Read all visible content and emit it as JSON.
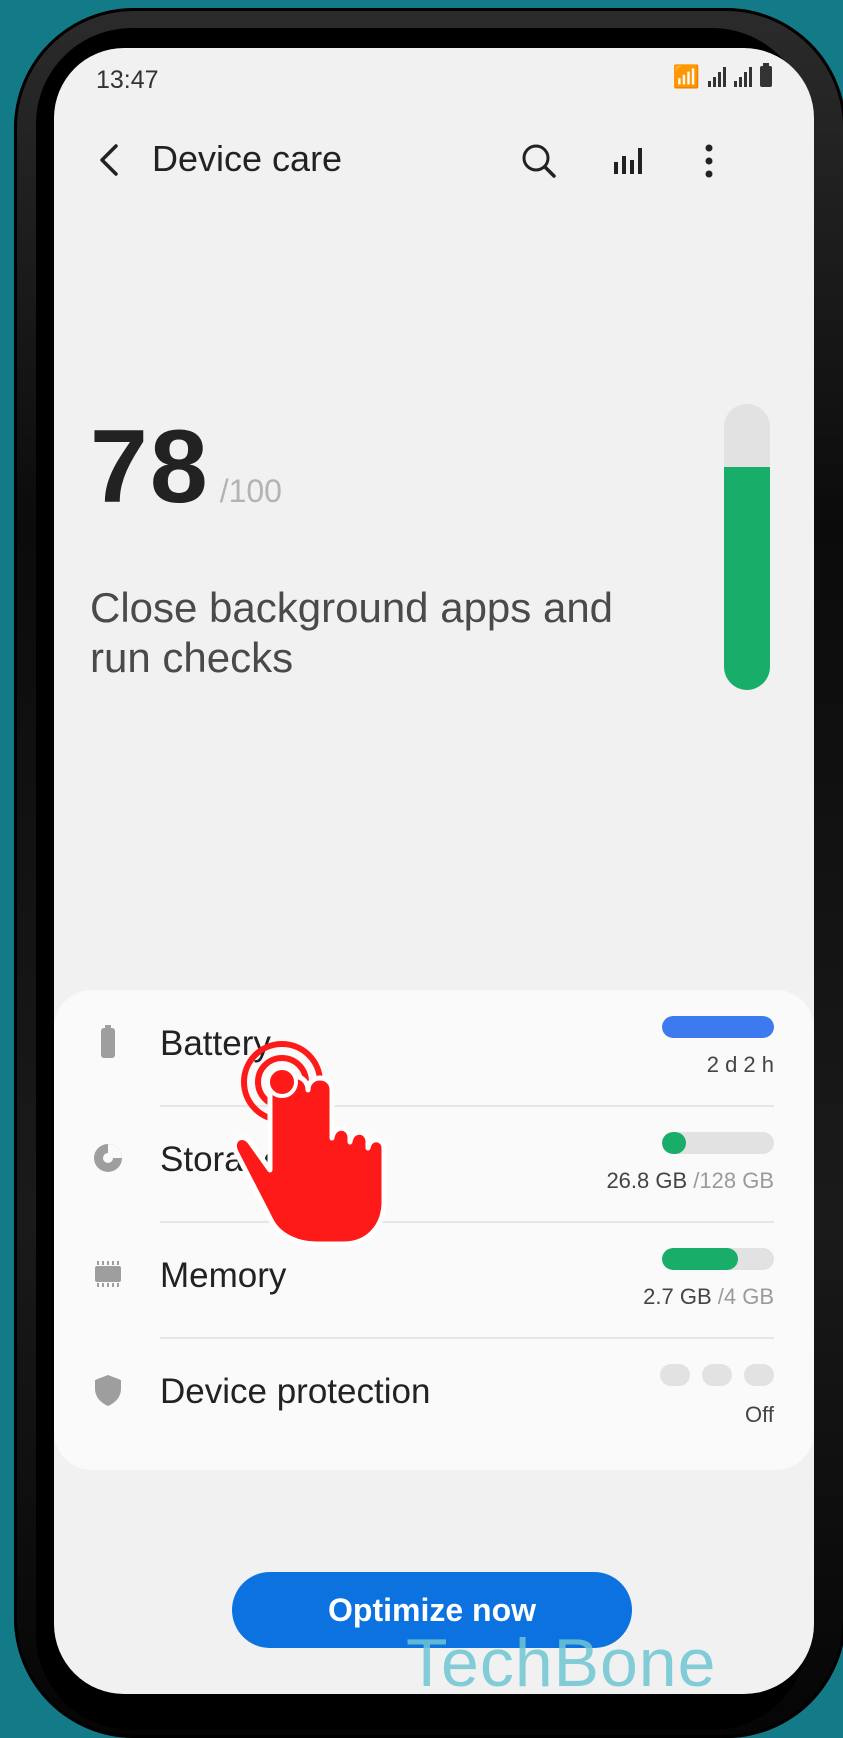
{
  "status_bar": {
    "time": "13:47"
  },
  "header": {
    "title": "Device care",
    "back_icon": "back-arrow-icon",
    "actions": [
      "search-icon",
      "stats-icon",
      "more-options-icon"
    ]
  },
  "score": {
    "value": "78",
    "max": "/100",
    "message": "Close background apps and run checks",
    "gauge_fraction": 0.78,
    "gauge_color": "#19ad6a"
  },
  "items": [
    {
      "label": "Battery",
      "value": "2 d 2 h",
      "bar_fraction": 1.0,
      "bar_color": "#3d7af0",
      "icon": "battery-icon"
    },
    {
      "label": "Storage",
      "value": "26.8 GB",
      "total": "/128 GB",
      "bar_fraction": 0.21,
      "bar_color": "#19ad6a",
      "icon": "storage-pie-icon"
    },
    {
      "label": "Memory",
      "value": "2.7 GB",
      "total": "/4 GB",
      "bar_fraction": 0.68,
      "bar_color": "#19ad6a",
      "icon": "memory-chip-icon"
    },
    {
      "label": "Device protection",
      "value": "Off",
      "icon": "shield-icon"
    }
  ],
  "optimize_button": {
    "label": "Optimize now",
    "color": "#0b72e0"
  },
  "watermark": "TechBone",
  "overlay": {
    "icon": "tap-hand-icon",
    "color": "#ff1a1a"
  }
}
